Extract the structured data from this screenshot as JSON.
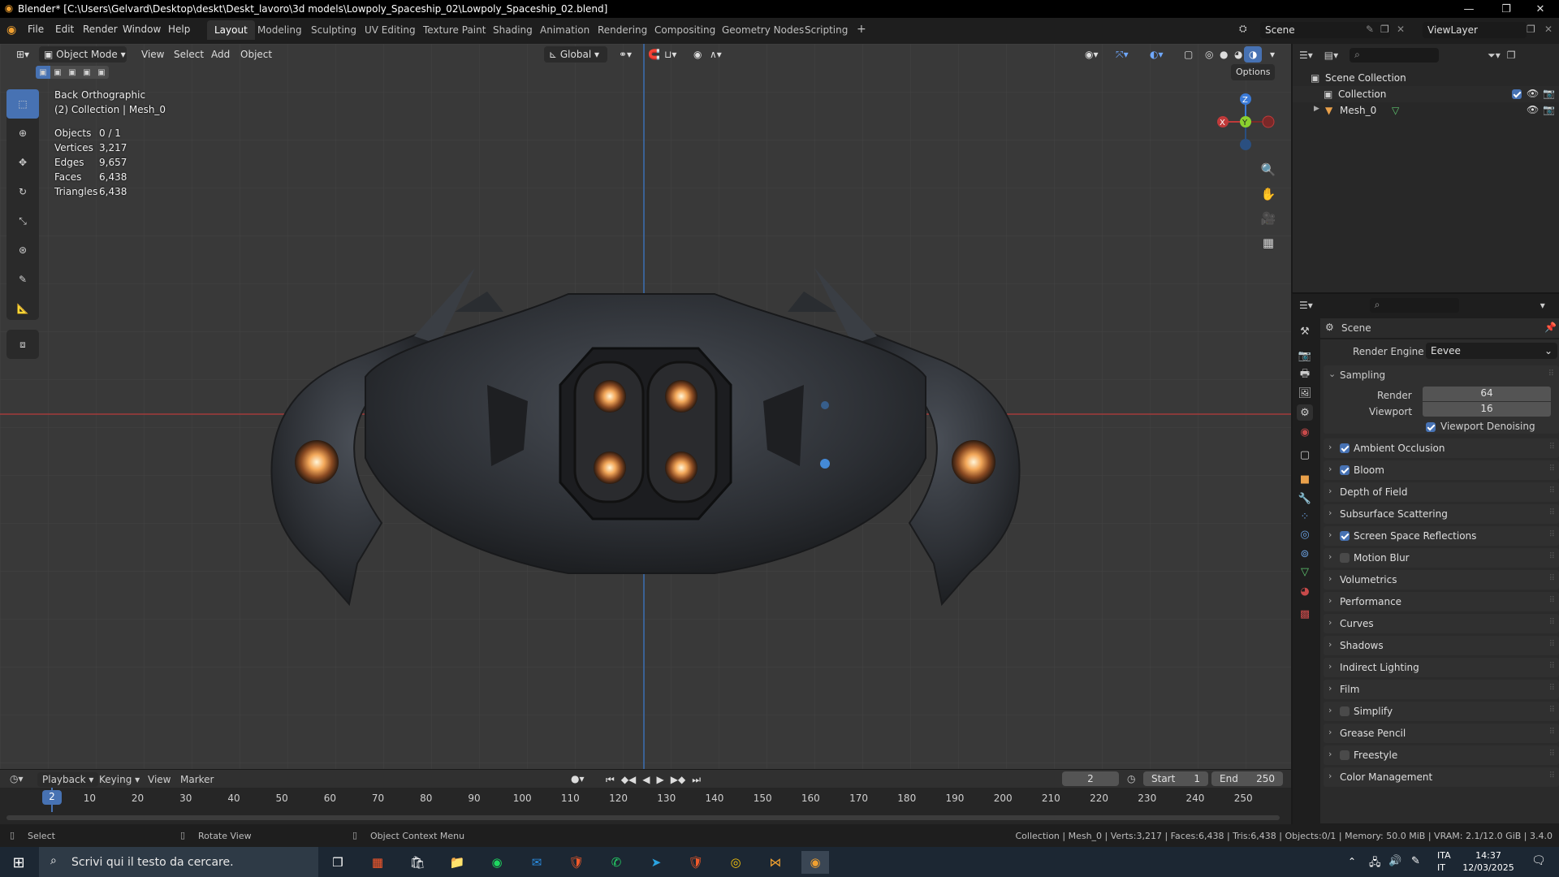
{
  "window": {
    "title": "Blender* [C:\\Users\\Gelvard\\Desktop\\deskt\\Deskt_lavoro\\3d models\\Lowpoly_Spaceship_02\\Lowpoly_Spaceship_02.blend]"
  },
  "menu": [
    "File",
    "Edit",
    "Render",
    "Window",
    "Help"
  ],
  "workspaces": [
    "Layout",
    "Modeling",
    "Sculpting",
    "UV Editing",
    "Texture Paint",
    "Shading",
    "Animation",
    "Rendering",
    "Compositing",
    "Geometry Nodes",
    "Scripting",
    "+"
  ],
  "scene_field": "Scene",
  "viewlayer_field": "ViewLayer",
  "viewport": {
    "mode": "Object Mode",
    "menus": [
      "View",
      "Select",
      "Add",
      "Object"
    ],
    "transform_orientation": "Global",
    "options_label": "Options",
    "view_name": "Back Orthographic",
    "collection_info": "(2) Collection | Mesh_0",
    "stats": [
      {
        "label": "Objects",
        "value": "0 / 1"
      },
      {
        "label": "Vertices",
        "value": "3,217"
      },
      {
        "label": "Edges",
        "value": "9,657"
      },
      {
        "label": "Faces",
        "value": "6,438"
      },
      {
        "label": "Triangles",
        "value": "6,438"
      }
    ],
    "gizmo": {
      "x": "X",
      "y": "Y",
      "z": "Z"
    }
  },
  "outliner": {
    "root": "Scene Collection",
    "items": [
      {
        "name": "Collection"
      },
      {
        "name": "Mesh_0"
      }
    ]
  },
  "properties": {
    "header": "Scene",
    "render_engine_label": "Render Engine",
    "render_engine_value": "Eevee",
    "sampling": {
      "title": "Sampling",
      "render_label": "Render",
      "render_value": "64",
      "viewport_label": "Viewport",
      "viewport_value": "16",
      "denoise_label": "Viewport Denoising"
    },
    "panels": [
      {
        "label": "Ambient Occlusion",
        "checkbox": "on"
      },
      {
        "label": "Bloom",
        "checkbox": "on"
      },
      {
        "label": "Depth of Field",
        "checkbox": "none"
      },
      {
        "label": "Subsurface Scattering",
        "checkbox": "none"
      },
      {
        "label": "Screen Space Reflections",
        "checkbox": "on"
      },
      {
        "label": "Motion Blur",
        "checkbox": "off"
      },
      {
        "label": "Volumetrics",
        "checkbox": "none"
      },
      {
        "label": "Performance",
        "checkbox": "none"
      },
      {
        "label": "Curves",
        "checkbox": "none"
      },
      {
        "label": "Shadows",
        "checkbox": "none"
      },
      {
        "label": "Indirect Lighting",
        "checkbox": "none"
      },
      {
        "label": "Film",
        "checkbox": "none"
      },
      {
        "label": "Simplify",
        "checkbox": "off"
      },
      {
        "label": "Grease Pencil",
        "checkbox": "none"
      },
      {
        "label": "Freestyle",
        "checkbox": "off"
      },
      {
        "label": "Color Management",
        "checkbox": "none"
      }
    ]
  },
  "timeline": {
    "menus": [
      "Playback",
      "Keying",
      "View",
      "Marker"
    ],
    "current_frame": "2",
    "start_label": "Start",
    "start_value": "1",
    "end_label": "End",
    "end_value": "250",
    "ticks": [
      "10",
      "20",
      "30",
      "40",
      "50",
      "60",
      "70",
      "80",
      "90",
      "100",
      "110",
      "120",
      "130",
      "140",
      "150",
      "160",
      "170",
      "180",
      "190",
      "200",
      "210",
      "220",
      "230",
      "240",
      "250"
    ],
    "playhead_label": "2"
  },
  "status": {
    "select": "Select",
    "rotate": "Rotate View",
    "context": "Object Context Menu",
    "info": "Collection | Mesh_0 | Verts:3,217 | Faces:6,438 | Tris:6,438 | Objects:0/1 | Memory: 50.0 MiB | VRAM: 2.1/12.0 GiB | 3.4.0"
  },
  "taskbar": {
    "search_placeholder": "Scrivi qui il testo da cercare.",
    "lang": "ITA",
    "lang2": "IT",
    "time": "14:37",
    "date": "12/03/2025"
  },
  "colors": {
    "accent": "#4772b3",
    "x_axis": "#c03a3a",
    "y_axis": "#8bd02f",
    "z_axis": "#3b7ad6"
  }
}
